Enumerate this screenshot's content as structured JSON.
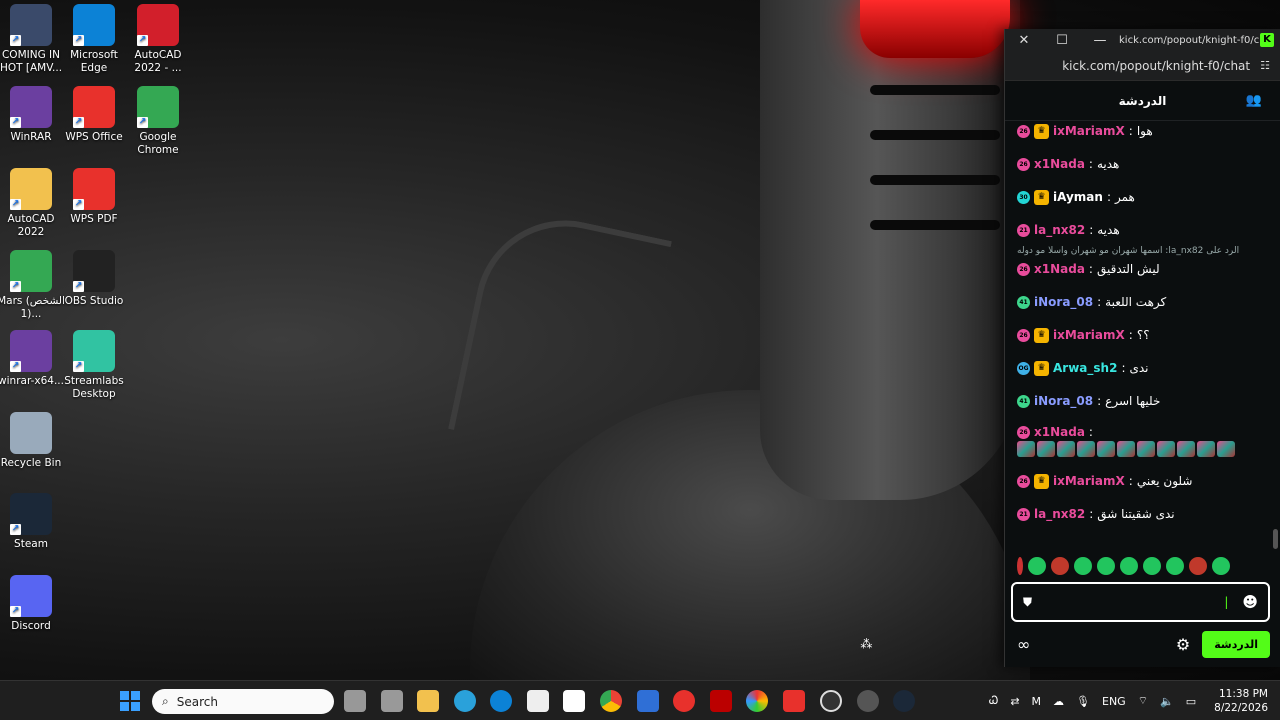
{
  "desktop": {
    "icons": [
      {
        "label": "COMING IN HOT [AMV...",
        "icon": "video-file-icon",
        "color": "#3a4a6a"
      },
      {
        "label": "Microsoft Edge",
        "icon": "edge-icon",
        "color": "#0c82d6"
      },
      {
        "label": "AutoCAD 2022 - ...",
        "icon": "autocad-icon",
        "color": "#d21f2b"
      },
      {
        "label": "WinRAR",
        "icon": "winrar-icon",
        "color": "#6b3fa0"
      },
      {
        "label": "WPS Office",
        "icon": "wps-office-icon",
        "color": "#e8312c"
      },
      {
        "label": "Google Chrome",
        "icon": "chrome-icon",
        "color": "#34a853"
      },
      {
        "label": "AutoCAD 2022",
        "icon": "folder-icon",
        "color": "#f2c14e"
      },
      {
        "label": "WPS PDF",
        "icon": "wps-pdf-icon",
        "color": "#e8312c"
      },
      {
        "label": "Mars (الشخص 1)...",
        "icon": "chrome-icon",
        "color": "#34a853"
      },
      {
        "label": "OBS Studio",
        "icon": "obs-icon",
        "color": "#222"
      },
      {
        "label": "winrar-x64...",
        "icon": "winrar-icon",
        "color": "#6b3fa0"
      },
      {
        "label": "Streamlabs Desktop",
        "icon": "streamlabs-icon",
        "color": "#31c3a2"
      },
      {
        "label": "Recycle Bin",
        "icon": "recycle-bin-icon",
        "color": "#9ab"
      },
      {
        "label": "Steam",
        "icon": "steam-icon",
        "color": "#1b2838"
      },
      {
        "label": "Discord",
        "icon": "discord-icon",
        "color": "#5865f2"
      }
    ]
  },
  "window": {
    "title": "kick.com/popout/knight-f0/c...",
    "address": "kick.com/popout/knight-f0/chat",
    "close": "✕",
    "maximize": "☐",
    "minimize": "—"
  },
  "chat": {
    "header": "الدردشة",
    "messages": [
      {
        "badge": "26",
        "badge_color": "#e94c9c",
        "user": "ixMariamX",
        "user_color": "#e94c9c",
        "text": "هوا",
        "crown": true
      },
      {
        "badge": "26",
        "badge_color": "#e94c9c",
        "user": "x1Nada",
        "user_color": "#e94c9c",
        "text": "هديه"
      },
      {
        "badge": "30",
        "badge_color": "#23d5d5",
        "user": "iAyman",
        "user_color": "#ffffff",
        "text": "همر",
        "crown": true
      },
      {
        "badge": "21",
        "badge_color": "#e94c9c",
        "user": "la_nx82",
        "user_color": "#e94c9c",
        "text": "هديه"
      },
      {
        "reply": "الرد على la_nx82: اسمها شهران مو شهران واسلا مو دوله"
      },
      {
        "badge": "26",
        "badge_color": "#e94c9c",
        "user": "x1Nada",
        "user_color": "#e94c9c",
        "text": "ليش التدقيق"
      },
      {
        "badge": "41",
        "badge_color": "#3dd68c",
        "user": "iNora_08",
        "user_color": "#8a9cff",
        "text": "كرهت اللعبة"
      },
      {
        "badge": "26",
        "badge_color": "#e94c9c",
        "user": "ixMariamX",
        "user_color": "#e94c9c",
        "text": "؟؟",
        "crown": true
      },
      {
        "badge": "OG",
        "badge_color": "#3fb1e8",
        "user": "Arwa_sh2",
        "user_color": "#39e6e0",
        "text": "ندى",
        "crown": true
      },
      {
        "badge": "41",
        "badge_color": "#3dd68c",
        "user": "iNora_08",
        "user_color": "#8a9cff",
        "text": "خليها اسرع"
      },
      {
        "badge": "26",
        "badge_color": "#e94c9c",
        "user": "x1Nada",
        "user_color": "#e94c9c",
        "text": "",
        "emotes": 11
      },
      {
        "badge": "26",
        "badge_color": "#e94c9c",
        "user": "ixMariamX",
        "user_color": "#e94c9c",
        "text": "شلون يعني",
        "crown": true
      },
      {
        "badge": "21",
        "badge_color": "#e94c9c",
        "user": "la_nx82",
        "user_color": "#e94c9c",
        "text": "ندى شقيتنا شق"
      }
    ],
    "send_label": "الدردشة"
  },
  "taskbar": {
    "search_placeholder": "Search",
    "lang": "ENG",
    "time": "11:38 PM",
    "date": "8/22/2026"
  }
}
